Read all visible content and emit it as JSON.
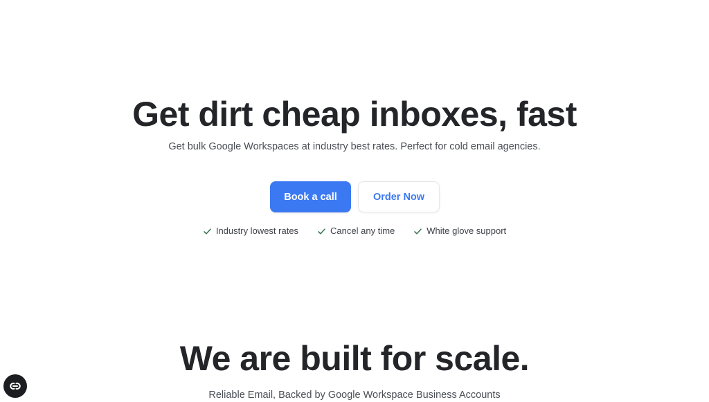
{
  "hero": {
    "title": "Get dirt cheap inboxes, fast",
    "subtitle": "Get bulk Google Workspaces at industry best rates. Perfect for cold email agencies.",
    "primary_button": "Book a call",
    "secondary_button": "Order Now",
    "features": [
      {
        "label": "Industry lowest rates",
        "icon": "check-icon"
      },
      {
        "label": "Cancel any time",
        "icon": "check-icon"
      },
      {
        "label": "White glove support",
        "icon": "check-icon"
      }
    ]
  },
  "scale_section": {
    "title": "We are built for scale.",
    "subtitle": "Reliable Email, Backed by Google Workspace Business Accounts"
  },
  "widget": {
    "icon": "chat-widget-icon"
  },
  "colors": {
    "accent": "#3b79f2",
    "check": "#3a7a55",
    "text": "#232529",
    "widget": "#1c1d20"
  }
}
